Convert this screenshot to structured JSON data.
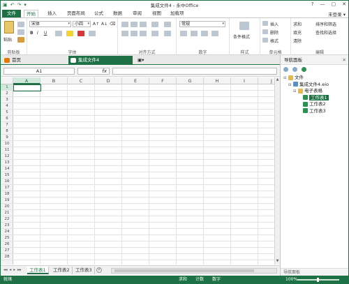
{
  "window": {
    "title": "集成文件4 - 永中Office",
    "controls": [
      "?",
      "—",
      "▢",
      "✕"
    ],
    "user": "未登录 ▾"
  },
  "quick_access": [
    "save-icon",
    "undo-icon",
    "redo-icon",
    "dropdown-icon"
  ],
  "menu": {
    "file": "文件",
    "tabs": [
      "开始",
      "插入",
      "页面布局",
      "公式",
      "数据",
      "审阅",
      "视图",
      "加载项"
    ]
  },
  "ribbon": {
    "clipboard": {
      "paste": "粘贴",
      "label": "剪贴板"
    },
    "font": {
      "name": "宋体",
      "size": "小四",
      "grow": "A↑",
      "shrink": "A↓",
      "clear": "⌫",
      "bold": "B",
      "italic": "I",
      "underline": "U",
      "label": "字体"
    },
    "alignment": {
      "label": "对齐方式"
    },
    "number": {
      "format": "常规",
      "label": "数字"
    },
    "styles": {
      "conditional": "条件格式",
      "label": "样式"
    },
    "cells": {
      "insert": "插入",
      "delete": "删除",
      "format": "格式",
      "label": "单元格"
    },
    "editing": {
      "sum": "求和",
      "sort": "排序和筛选",
      "fill": "填充",
      "find": "查找和选择",
      "clear": "清除",
      "label": "编辑"
    }
  },
  "doc_tabs": [
    {
      "label": "首页"
    },
    {
      "label": "集成文件4"
    }
  ],
  "formula_bar": {
    "name_box": "A1",
    "fx": "fx",
    "formula": ""
  },
  "grid": {
    "columns": [
      "A",
      "B",
      "C",
      "D",
      "E",
      "F",
      "G",
      "H",
      "I",
      "J"
    ],
    "rows": [
      "1",
      "2",
      "3",
      "4",
      "5",
      "6",
      "7",
      "8",
      "9",
      "10",
      "11",
      "12",
      "13",
      "14",
      "15",
      "16",
      "17",
      "18",
      "19",
      "20",
      "21",
      "22",
      "23",
      "24",
      "25",
      "26",
      "27",
      "28"
    ],
    "selected_cell": "A1"
  },
  "sheets": {
    "tabs": [
      "工作表1",
      "工作表2",
      "工作表3"
    ],
    "active": "工作表1",
    "nav": [
      "◂◂",
      "◂",
      "▸",
      "▸▸"
    ]
  },
  "status": {
    "ready": "就绪",
    "sum": "求和",
    "count": "计数",
    "mode": "数字",
    "zoom": "100%"
  },
  "nav_pane": {
    "title": "导航面板",
    "tree": [
      {
        "label": "文件",
        "level": 0,
        "icon": "folder"
      },
      {
        "label": "集成文件4.eio",
        "level": 1,
        "icon": "book"
      },
      {
        "label": "电子表格",
        "level": 2,
        "icon": "folder"
      },
      {
        "label": "工作表1",
        "level": 3,
        "icon": "sheet",
        "selected": true
      },
      {
        "label": "工作表2",
        "level": 3,
        "icon": "sheet"
      },
      {
        "label": "工作表3",
        "level": 3,
        "icon": "sheet"
      }
    ],
    "footer": "导航面板"
  },
  "colors": {
    "accent": "#1e7145",
    "home_tab": "#e07b00"
  }
}
